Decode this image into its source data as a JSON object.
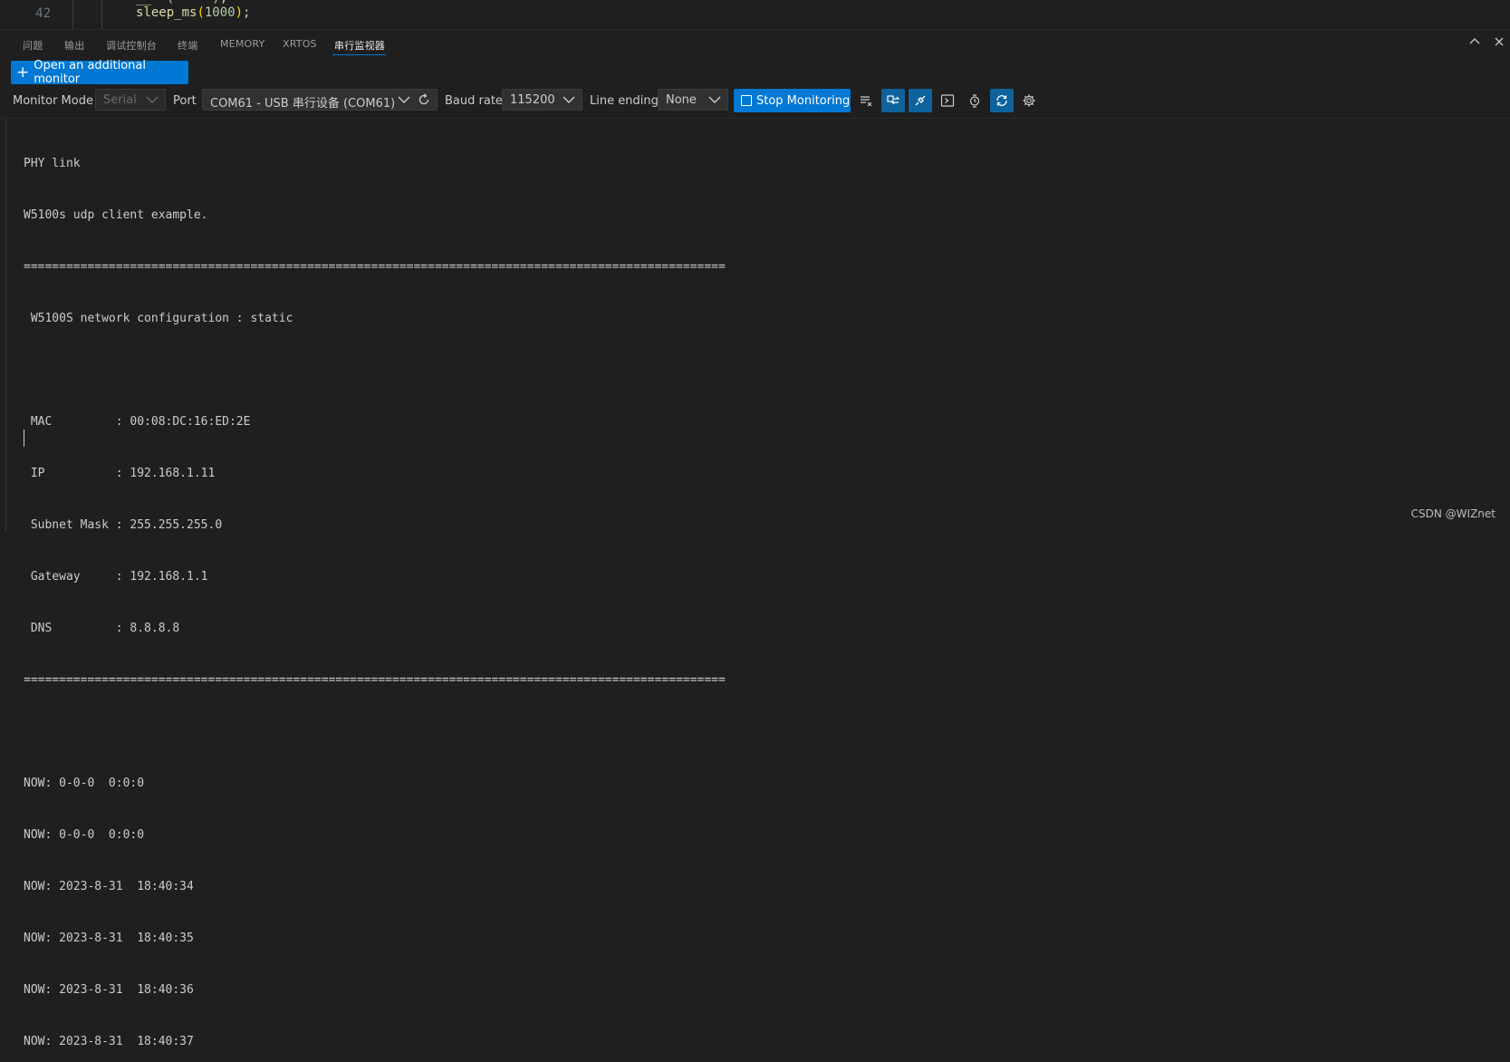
{
  "editor": {
    "line_number": "42",
    "code_fn": "sleep_ms",
    "code_open": "(",
    "code_arg": "1000",
    "code_close": ")",
    "code_end": ";"
  },
  "panel_tabs": [
    "问题",
    "输出",
    "调试控制台",
    "终端",
    "MEMORY",
    "XRTOS",
    "串行监视器"
  ],
  "active_tab_index": 6,
  "open_monitor_label": "Open an additional monitor",
  "toolbar": {
    "monitor_mode_label": "Monitor Mode",
    "monitor_mode_value": "Serial",
    "port_label": "Port",
    "port_value": "COM61 - USB 串行设备 (COM61)",
    "baud_label": "Baud rate",
    "baud_value": "115200",
    "line_ending_label": "Line ending",
    "line_ending_value": "None",
    "stop_label": "Stop Monitoring"
  },
  "icons": {
    "clear": "clear-output-icon",
    "swap": "toggle-hex-icon",
    "plug": "connect-icon",
    "terminal": "terminal-mode-icon",
    "timestamp": "timestamp-icon",
    "autoscroll": "autoscroll-icon",
    "settings": "gear-icon"
  },
  "accent_color": "#0078d4",
  "terminal_lines": [
    "PHY link",
    "W5100s udp client example.",
    "===================================================================================================",
    " W5100S network configuration : static",
    "",
    " MAC         : 00:08:DC:16:ED:2E",
    " IP          : 192.168.1.11",
    " Subnet Mask : 255.255.255.0",
    " Gateway     : 192.168.1.1",
    " DNS         : 8.8.8.8",
    "===================================================================================================",
    "",
    "NOW: 0-0-0  0:0:0",
    "NOW: 0-0-0  0:0:0",
    "NOW: 2023-8-31  18:40:34",
    "NOW: 2023-8-31  18:40:35",
    "NOW: 2023-8-31  18:40:36",
    "NOW: 2023-8-31  18:40:37"
  ],
  "watermark": "CSDN @WIZnet"
}
